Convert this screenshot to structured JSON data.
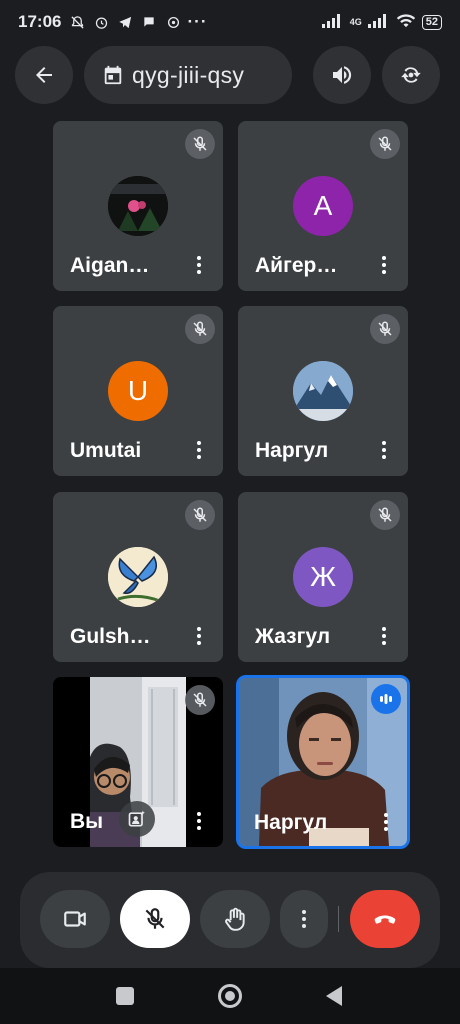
{
  "status_bar": {
    "time": "17:06",
    "network": "4G",
    "battery": "52"
  },
  "meeting": {
    "code": "qyg-jiii-qsy"
  },
  "participants": [
    {
      "name": "Aigan…",
      "avatar_letter": "",
      "avatar_color": "#1b1b1b"
    },
    {
      "name": "Айгер…",
      "avatar_letter": "A",
      "avatar_color": "#8e24aa"
    },
    {
      "name": "Umutai",
      "avatar_letter": "U",
      "avatar_color": "#ef6c00"
    },
    {
      "name": "Наргул",
      "avatar_letter": "",
      "avatar_color": "#5a7fa8"
    },
    {
      "name": "Gulsh…",
      "avatar_letter": "",
      "avatar_color": "#f0e6c8"
    },
    {
      "name": "Жазгул",
      "avatar_letter": "Ж",
      "avatar_color": "#7e57c2"
    },
    {
      "name": "Вы",
      "avatar_letter": "",
      "avatar_color": ""
    },
    {
      "name": "Наргул",
      "avatar_letter": "",
      "avatar_color": ""
    }
  ],
  "colors": {
    "background": "#1c1d20",
    "tile": "#3c4043",
    "active_border": "#1a73e8",
    "hangup": "#ea4335",
    "mic_off_button": "#ffffff"
  }
}
